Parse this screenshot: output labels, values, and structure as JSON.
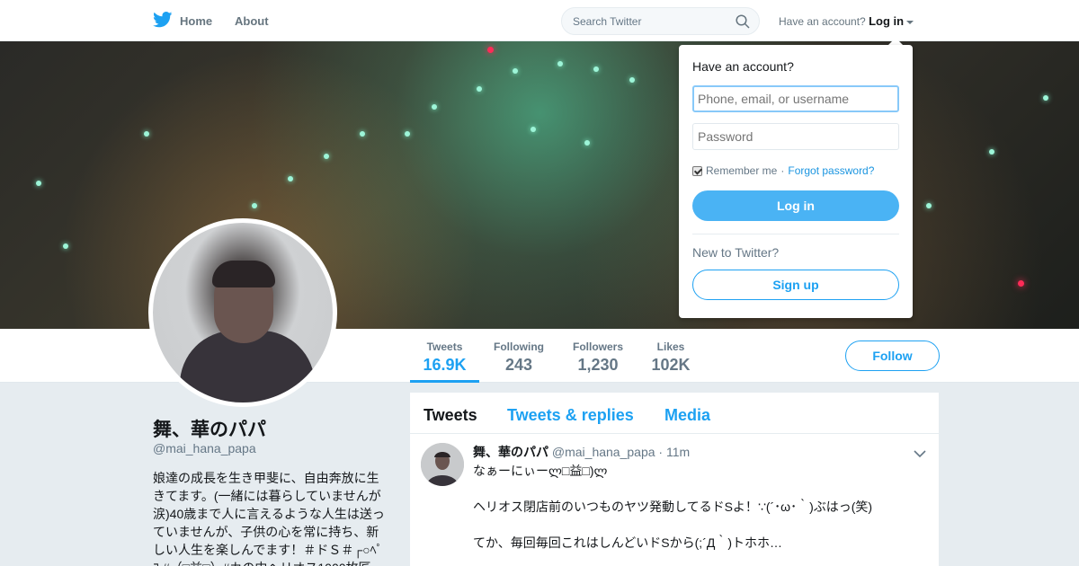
{
  "topnav": {
    "home_label": "Home",
    "about_label": "About",
    "search_placeholder": "Search Twitter",
    "account_prompt": "Have an account?",
    "login_label": "Log in"
  },
  "colors": {
    "accent": "#1da1f2",
    "login_button": "#4ab3f4",
    "muted": "#657786",
    "background": "#e6ecf0"
  },
  "profile": {
    "name": "舞、華のパパ",
    "handle": "@mai_hana_papa",
    "bio": "娘達の成長を生き甲斐に、自由奔放に生きてます。(一緒には暮らしていませんが涙)40歳まで人に言えるような人生は送っていませんが、子供の心を常に持ち、新しい人生を楽しんでます！＃ドＳ＃┌○ﾍﾟｺ #（□益□）#カの中ヘリオス1000枚匠",
    "stats": [
      {
        "label": "Tweets",
        "value": "16.9K",
        "active": true
      },
      {
        "label": "Following",
        "value": "243",
        "active": false
      },
      {
        "label": "Followers",
        "value": "1,230",
        "active": false
      },
      {
        "label": "Likes",
        "value": "102K",
        "active": false
      }
    ],
    "follow_label": "Follow"
  },
  "timeline": {
    "tabs": [
      "Tweets",
      "Tweets & replies",
      "Media"
    ],
    "active_tab": "Tweets",
    "tweet": {
      "name": "舞、華のパパ",
      "handle": "@mai_hana_papa",
      "time": "11m",
      "lines": [
        "なぁーにぃーლ□益□)ლ",
        "ヘリオス閉店前のいつものヤツ発動してるドSよ！∵(´･ω･｀)ぶはっ(笑)",
        "てか、毎回毎回これはしんどいドSから(;´Д｀)トホホ…"
      ]
    }
  },
  "login_dropdown": {
    "title": "Have an account?",
    "username_placeholder": "Phone, email, or username",
    "password_placeholder": "Password",
    "remember_label": "Remember me",
    "separator": "·",
    "forgot_label": "Forgot password?",
    "login_button": "Log in",
    "new_prompt": "New to Twitter?",
    "signup_button": "Sign up"
  },
  "icons": {
    "logo": "twitter-bird-icon",
    "search": "search-icon",
    "caret": "chevron-down-icon"
  }
}
